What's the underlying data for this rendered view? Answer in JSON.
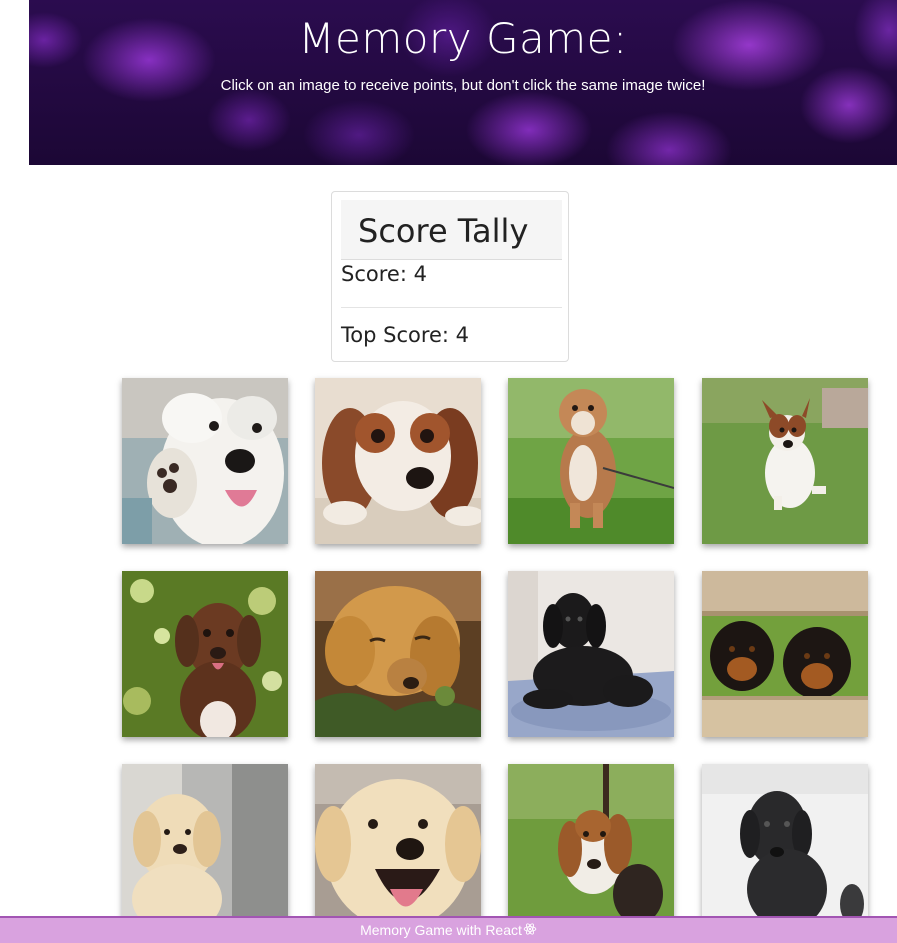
{
  "header": {
    "title": "Memory Game:",
    "subtitle": "Click on an image to receive points, but don't click the same image twice!"
  },
  "score_card": {
    "title": "Score Tally",
    "score_label": "Score: 4",
    "top_score_label": "Top Score: 4"
  },
  "images": [
    {
      "name": "white-terrier-puppy-image"
    },
    {
      "name": "cavalier-spaniel-puppy-image"
    },
    {
      "name": "bulldog-puppy-image"
    },
    {
      "name": "jack-russell-puppy-image"
    },
    {
      "name": "brown-lab-puppy-image"
    },
    {
      "name": "golden-retriever-puppy-image"
    },
    {
      "name": "black-lab-puppy-image"
    },
    {
      "name": "rottweiler-puppies-image"
    },
    {
      "name": "cream-lab-puppy-image"
    },
    {
      "name": "smiling-golden-puppy-image"
    },
    {
      "name": "beagle-puppy-image"
    },
    {
      "name": "black-puppy-image"
    }
  ],
  "footer": {
    "text": "Memory Game with React",
    "icon": "react-icon"
  }
}
